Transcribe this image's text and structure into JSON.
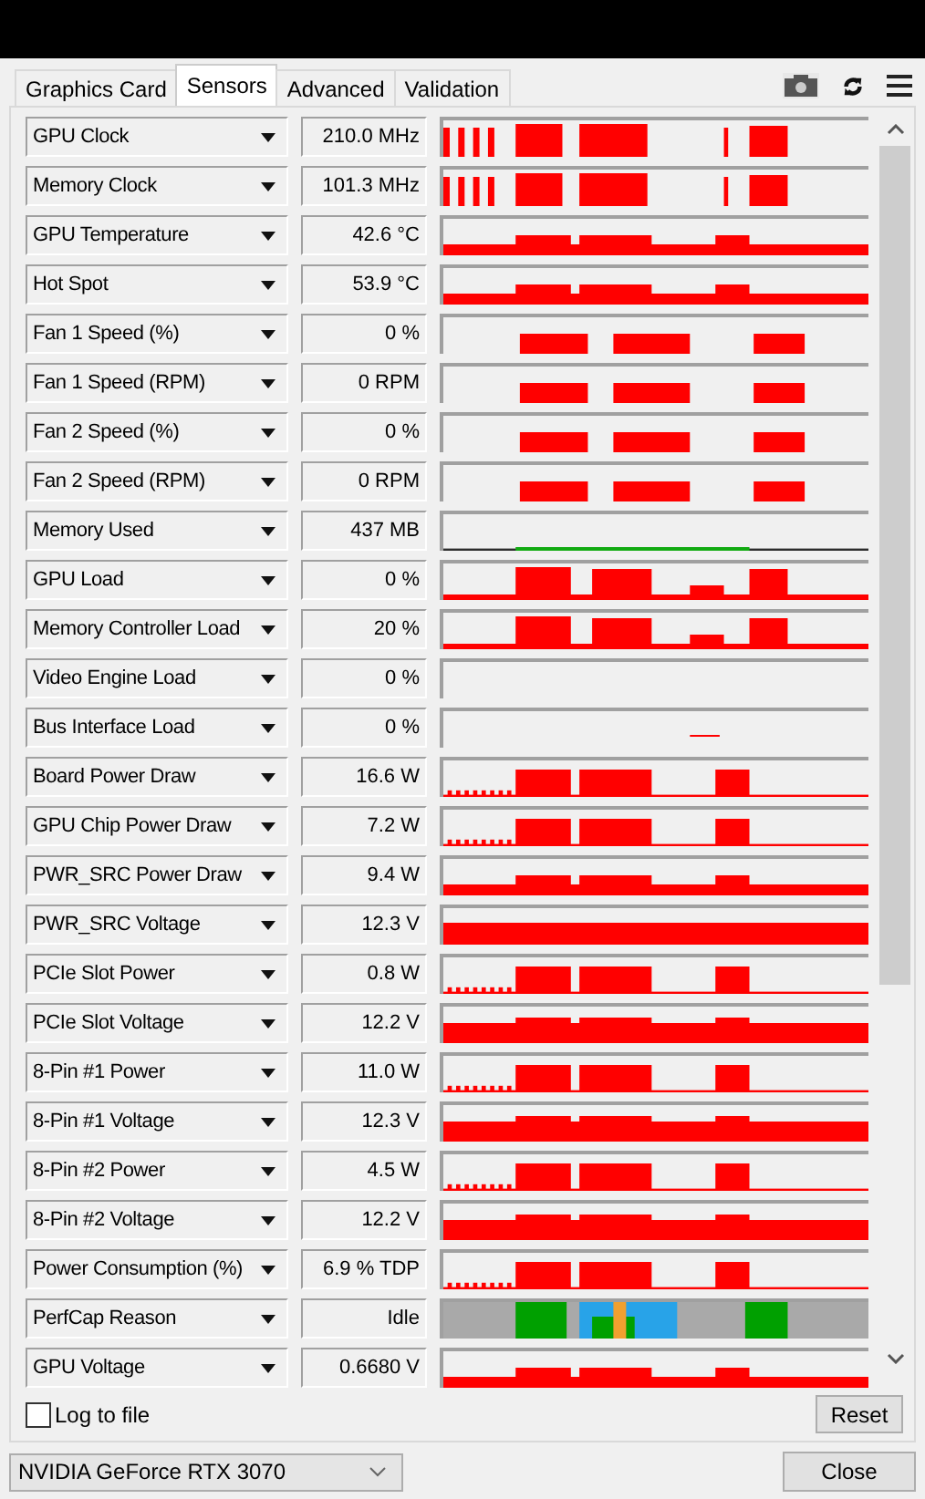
{
  "tabs": [
    {
      "label": "Graphics Card",
      "selected": false
    },
    {
      "label": "Sensors",
      "selected": true
    },
    {
      "label": "Advanced",
      "selected": false
    },
    {
      "label": "Validation",
      "selected": false
    }
  ],
  "sensors": [
    {
      "name": "GPU Clock",
      "value": "210.0 MHz",
      "kind": "bursts"
    },
    {
      "name": "Memory Clock",
      "value": "101.3 MHz",
      "kind": "bursts"
    },
    {
      "name": "GPU Temperature",
      "value": "42.6 °C",
      "kind": "load"
    },
    {
      "name": "Hot Spot",
      "value": "53.9 °C",
      "kind": "load"
    },
    {
      "name": "Fan 1 Speed (%)",
      "value": "0 %",
      "kind": "hump"
    },
    {
      "name": "Fan 1 Speed (RPM)",
      "value": "0 RPM",
      "kind": "hump"
    },
    {
      "name": "Fan 2 Speed (%)",
      "value": "0 %",
      "kind": "hump"
    },
    {
      "name": "Fan 2 Speed (RPM)",
      "value": "0 RPM",
      "kind": "hump"
    },
    {
      "name": "Memory Used",
      "value": "437 MB",
      "kind": "line"
    },
    {
      "name": "GPU Load",
      "value": "0 %",
      "kind": "spiky"
    },
    {
      "name": "Memory Controller Load",
      "value": "20 %",
      "kind": "spiky"
    },
    {
      "name": "Video Engine Load",
      "value": "0 %",
      "kind": "blank"
    },
    {
      "name": "Bus Interface Load",
      "value": "0 %",
      "kind": "dash"
    },
    {
      "name": "Board Power Draw",
      "value": "16.6 W",
      "kind": "power"
    },
    {
      "name": "GPU Chip Power Draw",
      "value": "7.2 W",
      "kind": "power"
    },
    {
      "name": "PWR_SRC Power Draw",
      "value": "9.4 W",
      "kind": "load"
    },
    {
      "name": "PWR_SRC Voltage",
      "value": "12.3 V",
      "kind": "full"
    },
    {
      "name": "PCIe Slot Power",
      "value": "0.8 W",
      "kind": "power"
    },
    {
      "name": "PCIe Slot Voltage",
      "value": "12.2 V",
      "kind": "voltage"
    },
    {
      "name": "8-Pin #1 Power",
      "value": "11.0 W",
      "kind": "power"
    },
    {
      "name": "8-Pin #1 Voltage",
      "value": "12.3 V",
      "kind": "voltage"
    },
    {
      "name": "8-Pin #2 Power",
      "value": "4.5 W",
      "kind": "power"
    },
    {
      "name": "8-Pin #2 Voltage",
      "value": "12.2 V",
      "kind": "voltage"
    },
    {
      "name": "Power Consumption (%)",
      "value": "6.9 % TDP",
      "kind": "power"
    },
    {
      "name": "PerfCap Reason",
      "value": "Idle",
      "kind": "perfcap"
    },
    {
      "name": "GPU Voltage",
      "value": "0.6680 V",
      "kind": "load"
    }
  ],
  "log_to_file": {
    "label": "Log to file",
    "checked": false
  },
  "reset_button": "Reset",
  "gpu_select": "NVIDIA GeForce RTX 3070",
  "close_button": "Close"
}
